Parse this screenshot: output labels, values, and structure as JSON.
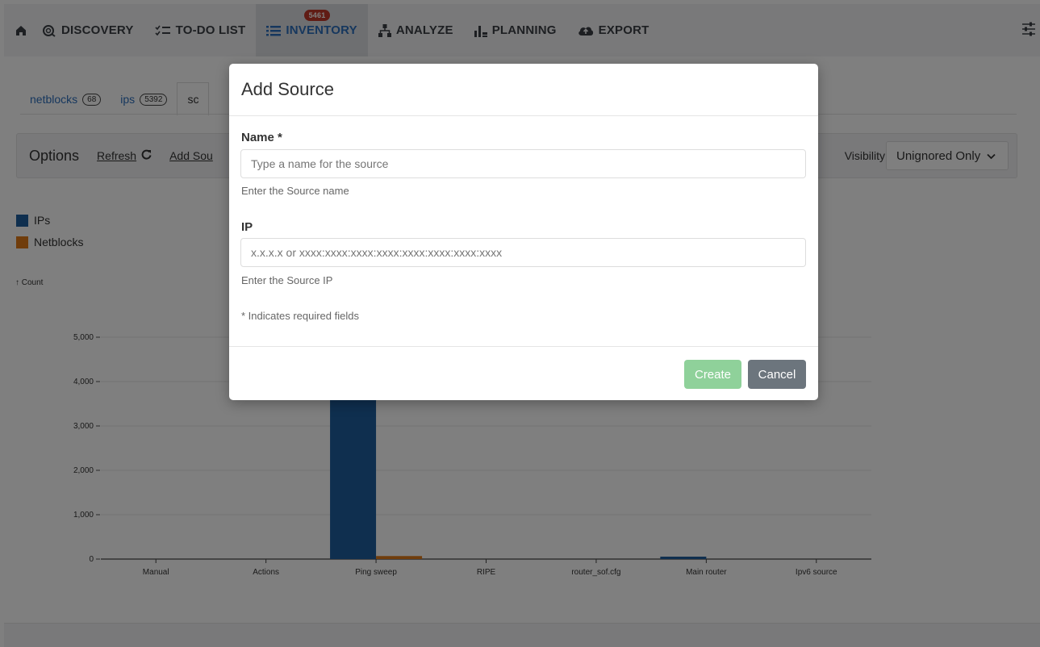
{
  "nav": {
    "items": [
      {
        "label": "DISCOVERY",
        "icon": "discovery-icon"
      },
      {
        "label": "TO-DO LIST",
        "icon": "todo-icon"
      },
      {
        "label": "INVENTORY",
        "icon": "list-icon",
        "badge": "5461",
        "active": true
      },
      {
        "label": "ANALYZE",
        "icon": "hierarchy-icon"
      },
      {
        "label": "PLANNING",
        "icon": "bar-chart-icon"
      },
      {
        "label": "EXPORT",
        "icon": "cloud-icon"
      }
    ]
  },
  "tabs": [
    {
      "label": "netblocks",
      "count": "68"
    },
    {
      "label": "ips",
      "count": "5392"
    },
    {
      "label": "sc",
      "count": ""
    }
  ],
  "options": {
    "title": "Options",
    "refresh": "Refresh",
    "add_source": "Add Sou",
    "visibility_label": "Visibility",
    "visibility_value": "Unignored Only"
  },
  "legend": [
    {
      "label": "IPs",
      "color": "#1f5f9e"
    },
    {
      "label": "Netblocks",
      "color": "#e07b18"
    }
  ],
  "count_label": "↑ Count",
  "chart_data": {
    "type": "bar",
    "categories": [
      "Manual",
      "Actions",
      "Ping sweep",
      "RIPE",
      "router_sof.cfg",
      "Main router",
      "Ipv6 source"
    ],
    "series": [
      {
        "name": "IPs",
        "values": [
          0,
          0,
          5340,
          0,
          0,
          30,
          0
        ]
      },
      {
        "name": "Netblocks",
        "values": [
          0,
          0,
          68,
          0,
          0,
          0,
          0
        ]
      }
    ],
    "yticks": [
      "0",
      "1,000",
      "2,000",
      "3,000",
      "4,000",
      "5,000"
    ],
    "ylim": [
      0,
      5000
    ],
    "ylabel": "↑ Count",
    "xlabel": ""
  },
  "modal": {
    "title": "Add Source",
    "name_label": "Name *",
    "name_placeholder": "Type a name for the source",
    "name_help": "Enter the Source name",
    "ip_label": "IP",
    "ip_placeholder": "x.x.x.x or xxxx:xxxx:xxxx:xxxx:xxxx:xxxx:xxxx:xxxx",
    "ip_help": "Enter the Source IP",
    "required_note": "* Indicates required fields",
    "create_label": "Create",
    "cancel_label": "Cancel"
  }
}
